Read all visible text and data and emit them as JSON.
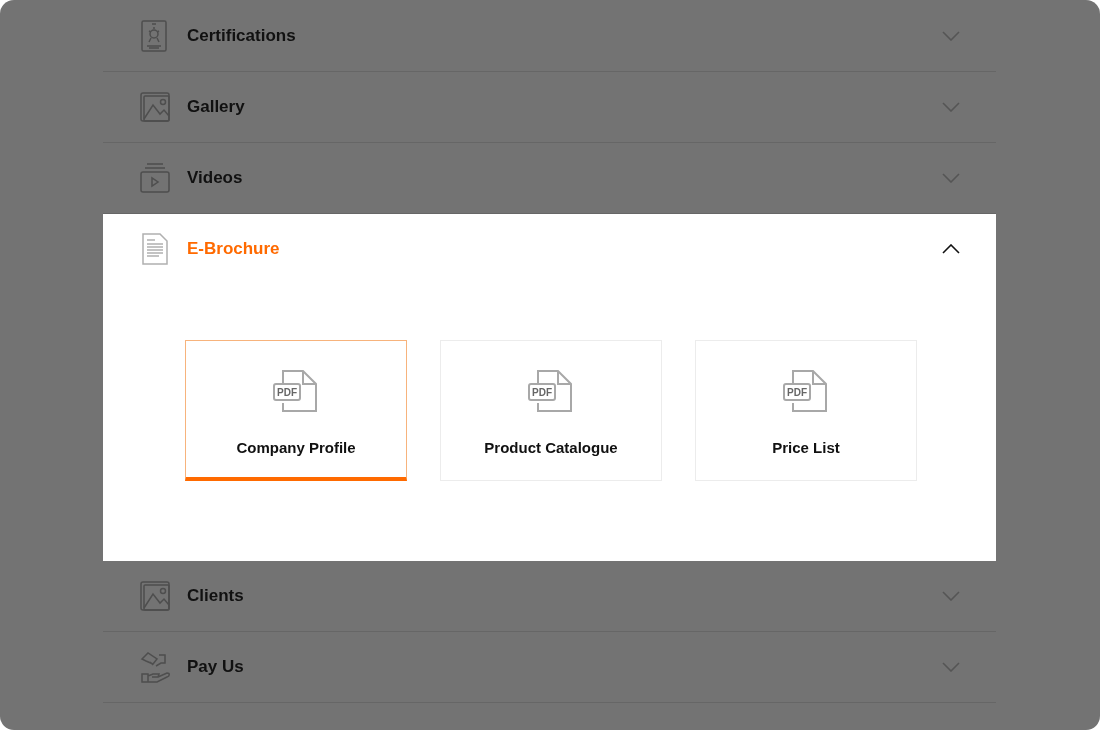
{
  "sections": [
    {
      "title": "Certifications",
      "expanded": false
    },
    {
      "title": "Gallery",
      "expanded": false
    },
    {
      "title": "Videos",
      "expanded": false
    },
    {
      "title": "E-Brochure",
      "expanded": true,
      "files": [
        {
          "badge": "PDF",
          "label": "Company Profile",
          "selected": true
        },
        {
          "badge": "PDF",
          "label": "Product Catalogue",
          "selected": false
        },
        {
          "badge": "PDF",
          "label": "Price List",
          "selected": false
        }
      ]
    },
    {
      "title": "Clients",
      "expanded": false
    },
    {
      "title": "Pay Us",
      "expanded": false
    }
  ]
}
